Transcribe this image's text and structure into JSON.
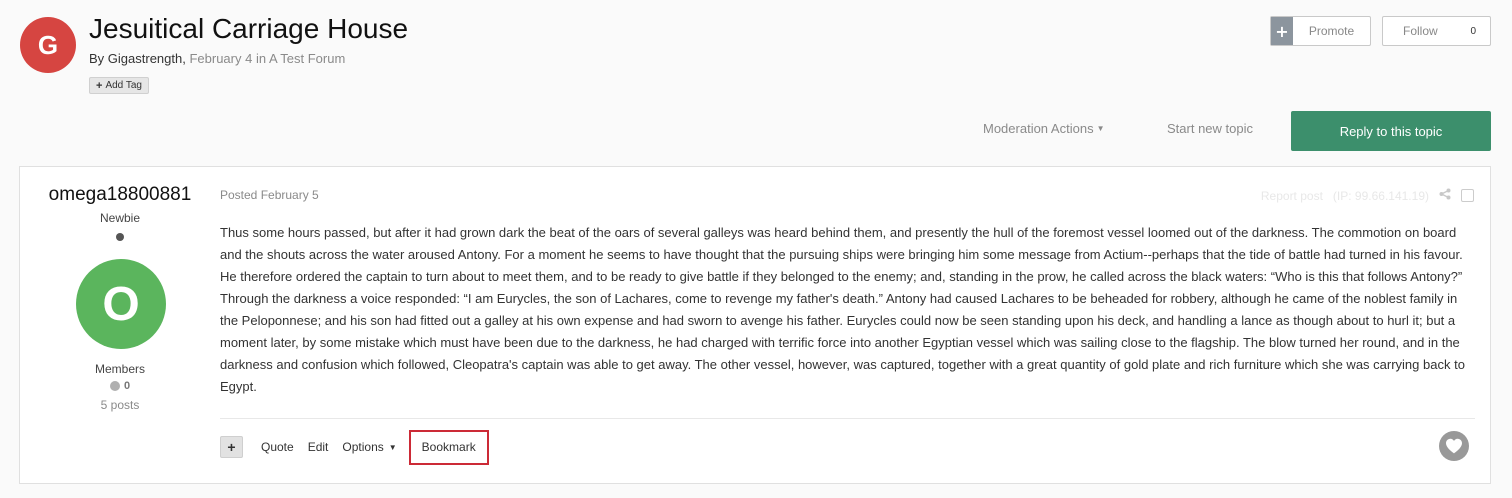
{
  "topic": {
    "avatar_letter": "G",
    "avatar_color": "#d64541",
    "title": "Jesuitical Carriage House",
    "by_label": "By",
    "author": "Gigastrength,",
    "date_forum": "February 4 in A Test Forum",
    "add_tag": "Add Tag"
  },
  "header_actions": {
    "promote": "Promote",
    "follow": "Follow",
    "follow_count": "0",
    "moderation": "Moderation Actions",
    "start_new_topic": "Start new topic",
    "reply": "Reply to this topic",
    "reply_color": "#3c8f6c"
  },
  "post": {
    "author_name": "omega18800881",
    "rank": "Newbie",
    "avatar_letter": "O",
    "avatar_color": "#5bb55d",
    "group": "Members",
    "reputation": "0",
    "post_count": "5 posts",
    "posted": "Posted February 5",
    "report": "Report post",
    "ip": "(IP: 99.66.141.19)",
    "body": "Thus some hours passed, but after it had grown dark the beat of the oars of several galleys was heard behind them, and presently the hull of the foremost vessel loomed out of the darkness. The commotion on board and the shouts across the water aroused Antony. For a moment he seems to have thought that the pursuing ships were bringing him some message from Actium--perhaps that the tide of battle had turned in his favour. He therefore ordered the captain to turn about to meet them, and to be ready to give battle if they belonged to the enemy; and, standing in the prow, he called across the black waters: “Who is this that follows Antony?” Through the darkness a voice responded: “I am Eurycles, the son of Lachares, come to revenge my father's death.” Antony had caused Lachares to be beheaded for robbery, although he came of the noblest family in the Peloponnese; and his son had fitted out a galley at his own expense and had sworn to avenge his father. Eurycles could now be seen standing upon his deck, and handling a lance as though about to hurl it; but a moment later, by some mistake which must have been due to the darkness, he had charged with terrific force into another Egyptian vessel which was sailing close to the flagship. The blow turned her round, and in the darkness and confusion which followed, Cleopatra's captain was able to get away. The other vessel, however, was captured, together with a great quantity of gold plate and rich furniture which she was carrying back to Egypt.",
    "controls": {
      "quote": "Quote",
      "edit": "Edit",
      "options": "Options",
      "bookmark": "Bookmark"
    },
    "highlight_color": "#cc2a36"
  }
}
